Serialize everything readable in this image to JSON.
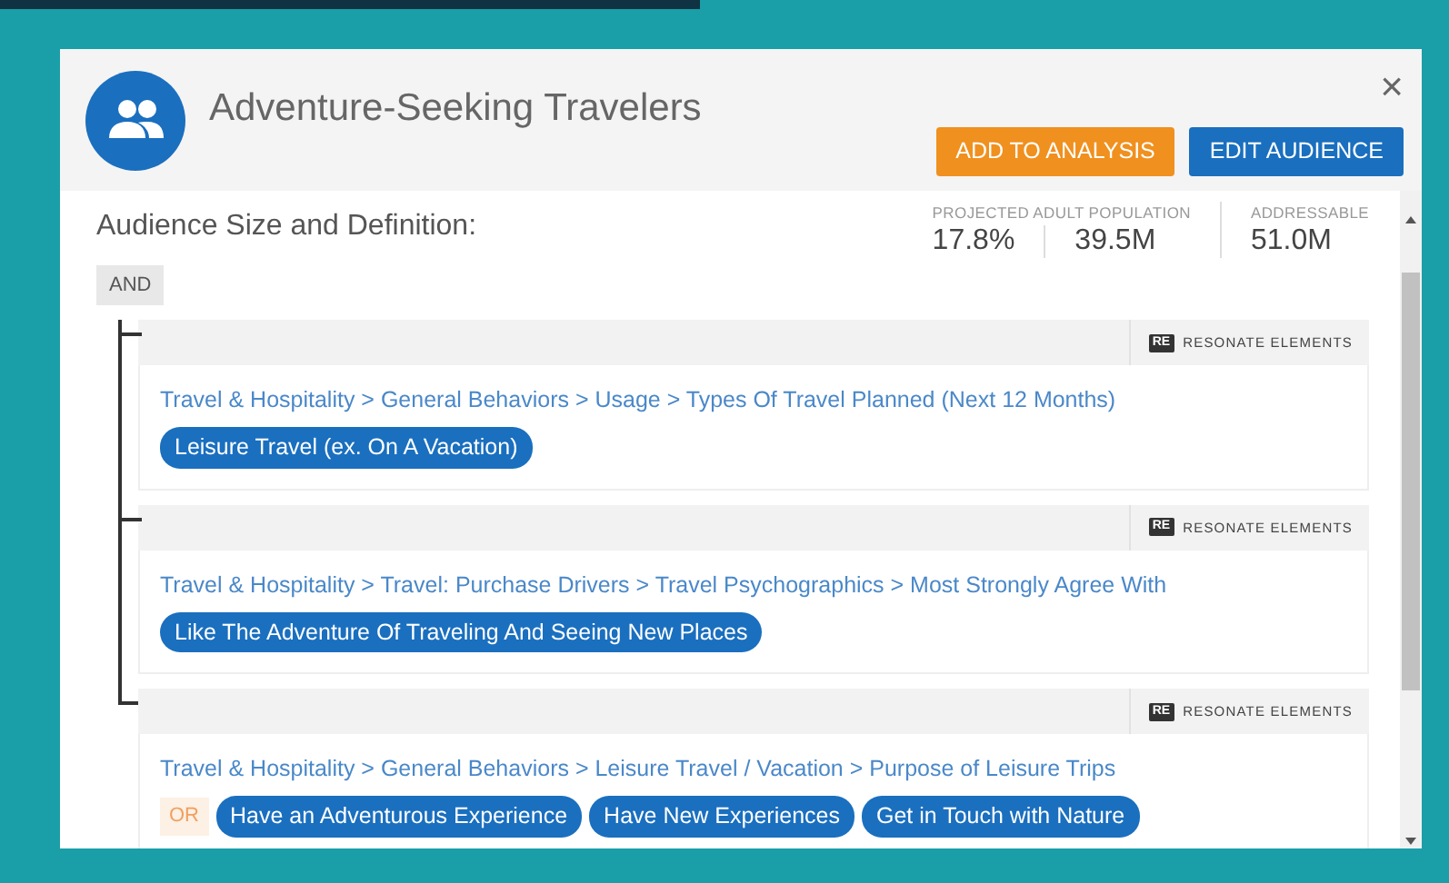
{
  "modal": {
    "title": "Adventure-Seeking Travelers",
    "close": "×",
    "buttons": [
      {
        "label": "ADD TO ANALYSIS",
        "kind": "secondary"
      },
      {
        "label": "EDIT AUDIENCE",
        "kind": "primary"
      }
    ]
  },
  "section_title": "Audience Size and Definition:",
  "stats": [
    {
      "label": "PROJECTED ADULT POPULATION",
      "values": [
        "17.8%",
        "39.5M"
      ]
    },
    {
      "label": "ADDRESSABLE",
      "values": [
        "51.0M"
      ]
    }
  ],
  "logic": "AND",
  "conditions": [
    {
      "badge": "RE",
      "source": "RESONATE ELEMENTS",
      "path": "Travel & Hospitality > General Behaviors > Usage > Types Of Travel Planned (Next 12 Months)",
      "values": [
        "Leisure Travel (ex. On A Vacation)"
      ]
    },
    {
      "badge": "RE",
      "source": "RESONATE ELEMENTS",
      "path": "Travel & Hospitality > Travel: Purchase Drivers > Travel Psychographics > Most Strongly Agree With",
      "values": [
        "Like The Adventure Of Traveling And Seeing New Places"
      ]
    },
    {
      "badge": "RE",
      "source": "RESONATE ELEMENTS",
      "path": "Travel & Hospitality > General Behaviors > Leisure Travel / Vacation > Purpose of Leisure Trips",
      "operator": "OR",
      "values": [
        "Have an Adventurous Experience",
        "Have New Experiences",
        "Get in Touch with Nature"
      ]
    }
  ]
}
